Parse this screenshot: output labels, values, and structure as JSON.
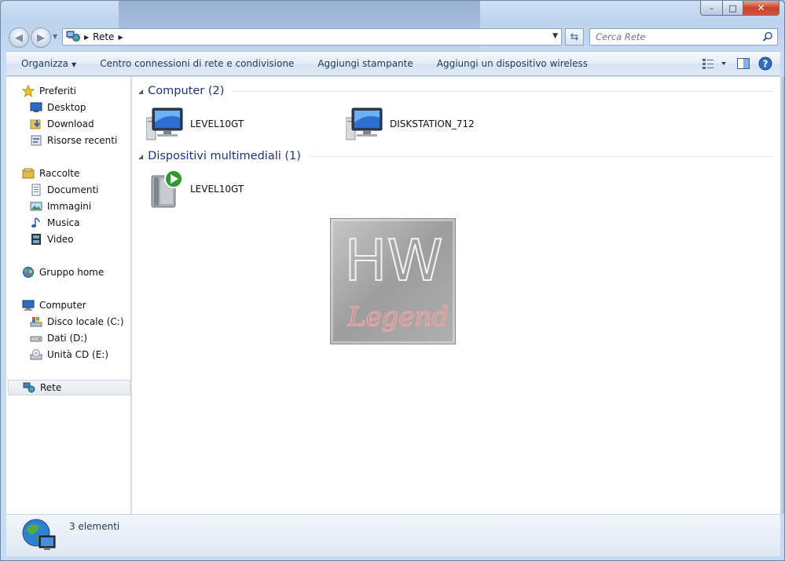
{
  "window": {
    "caption": {
      "minimize": "–",
      "maximize": "□",
      "close": "✕"
    }
  },
  "address": {
    "crumbs": [
      "Rete"
    ],
    "search_placeholder": "Cerca Rete"
  },
  "commandbar": {
    "items": [
      "Organizza",
      "Centro connessioni di rete e condivisione",
      "Aggiungi stampante",
      "Aggiungi un dispositivo wireless"
    ],
    "organize_arrow": "▼"
  },
  "navigation": {
    "favorites": {
      "label": "Preferiti",
      "items": [
        "Desktop",
        "Download",
        "Risorse recenti"
      ]
    },
    "libraries": {
      "label": "Raccolte",
      "items": [
        "Documenti",
        "Immagini",
        "Musica",
        "Video"
      ]
    },
    "homegroup": {
      "label": "Gruppo home"
    },
    "computer": {
      "label": "Computer",
      "items": [
        "Disco locale (C:)",
        "Dati (D:)",
        "Unità CD (E:)"
      ]
    },
    "network": {
      "label": "Rete"
    }
  },
  "content": {
    "groups": [
      {
        "title": "Computer (2)",
        "items": [
          "LEVEL10GT",
          "DISKSTATION_712"
        ]
      },
      {
        "title": "Dispositivi multimediali (1)",
        "items": [
          "LEVEL10GT"
        ]
      }
    ]
  },
  "watermark": {
    "line1": "HW",
    "line2": "Legend"
  },
  "details": {
    "count": "3 elementi"
  },
  "colors": {
    "group_title": "#1e3287",
    "command_text": "#1e395b",
    "close_button": "#c7452c"
  }
}
